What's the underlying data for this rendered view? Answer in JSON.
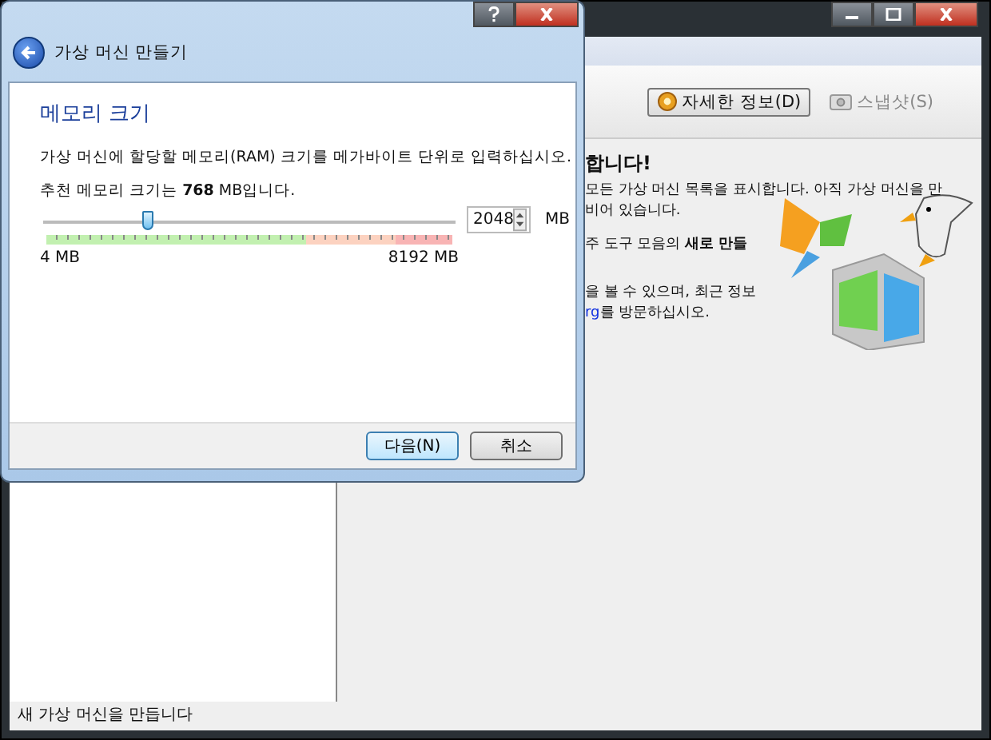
{
  "main_window": {
    "toolbar": [
      {
        "label": "자세한 정보(D)",
        "kind": "details",
        "selected": true
      },
      {
        "label": "스냅샷(S)",
        "kind": "snapshot",
        "selected": false
      }
    ],
    "welcome": {
      "heading": "합니다!",
      "lines": [
        {
          "text": "모든 가상 머신 목록을 표시합니다. 아직 가상 머신을 만"
        },
        {
          "text": "비어 있습니다."
        },
        {
          "text": "주 도구 모음의 **새로 만들**"
        },
        {
          "text": "을 볼 수 있으며, 최근 정보"
        },
        {
          "link": "rg",
          "text": "를 방문하십시오."
        }
      ]
    },
    "status_bar": "새 가상 머신을 만듭니다"
  },
  "dialog": {
    "title": "가상 머신 만들기",
    "heading": "메모리 크기",
    "description": "가상 머신에 할당할 메모리(RAM) 크기를 메가바이트 단위로 입력하십시오.",
    "recommendation": "추천 메모리 크기는 **768** MB입니다.",
    "slider": {
      "level": 0.25,
      "min_label": "4 MB",
      "max_label": "8192 MB"
    },
    "spinbox": {
      "value": "2048",
      "unit": "MB"
    },
    "buttons": [
      {
        "label": "다음(N)",
        "kind": "default"
      },
      {
        "label": "취소",
        "kind": "normal"
      }
    ]
  }
}
